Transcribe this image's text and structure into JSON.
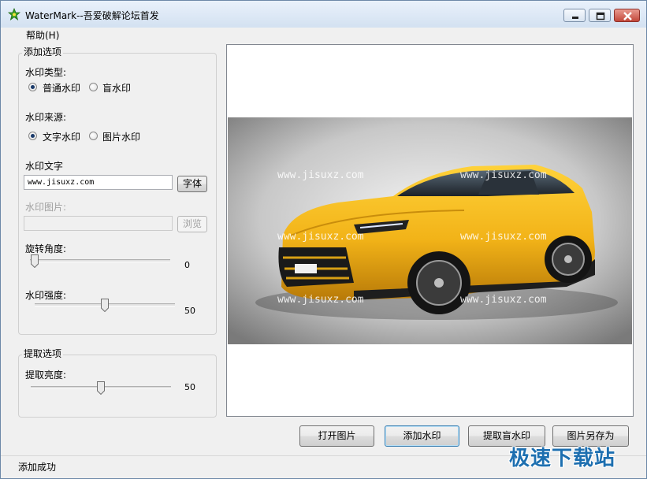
{
  "window": {
    "title": "WaterMark--吾爱破解论坛首发"
  },
  "menu": {
    "help": "帮助(H)"
  },
  "add_group": {
    "title": "添加选项",
    "type_label": "水印类型:",
    "type_options": [
      "普通水印",
      "盲水印"
    ],
    "type_selected": "普通水印",
    "source_label": "水印来源:",
    "source_options": [
      "文字水印",
      "图片水印"
    ],
    "source_selected": "文字水印",
    "text_label": "水印文字",
    "text_value": "www.jisuxz.com",
    "font_button": "字体",
    "image_label": "水印图片:",
    "image_value": "",
    "browse_button": "浏览",
    "rotation_label": "旋转角度:",
    "rotation_value": "0",
    "strength_label": "水印强度:",
    "strength_value": "50"
  },
  "extract_group": {
    "title": "提取选项",
    "brightness_label": "提取亮度:",
    "brightness_value": "50"
  },
  "preview": {
    "watermark_text": "www.jisuxz.com",
    "car_color": "#f2b318"
  },
  "buttons": {
    "open": "打开图片",
    "add": "添加水印",
    "extract": "提取盲水印",
    "save_as": "图片另存为"
  },
  "status": {
    "text": "添加成功"
  },
  "brand": {
    "text": "极速下载站"
  }
}
